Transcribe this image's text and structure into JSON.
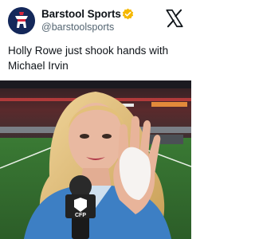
{
  "post": {
    "author_name": "Barstool Sports",
    "author_handle": "@barstoolsports",
    "text": "Holly Rowe just shook hands with Michael Irvin",
    "verified": true
  },
  "icons": {
    "avatar": "barstool-logo-avatar",
    "verified": "verified-badge-icon",
    "platform": "x-logo-icon"
  },
  "media": {
    "mic_flag_text": "CFP",
    "description_colors": {
      "field": "#2f6b2c",
      "jacket": "#3d7fc4",
      "hair": "#d9b774"
    }
  },
  "colors": {
    "verified_badge": "#f5b800",
    "handle_text": "#536471",
    "avatar_bg": "#14285a"
  }
}
